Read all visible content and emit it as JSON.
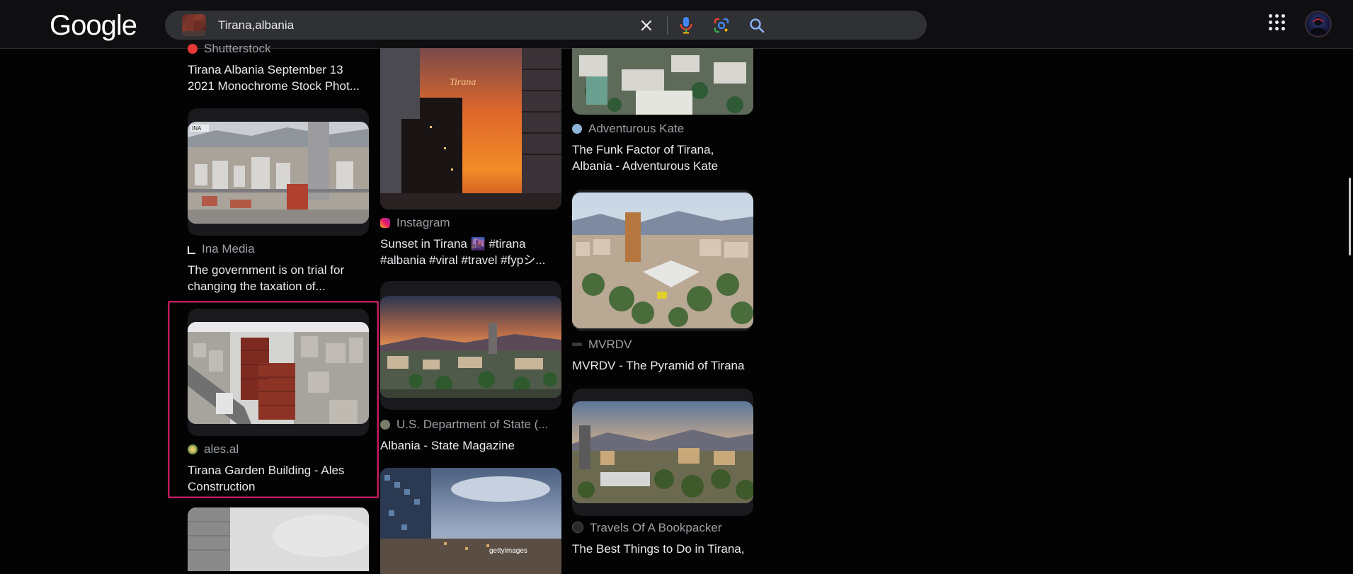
{
  "header": {
    "logo": "Google",
    "search": {
      "value": "Tirana,albania",
      "thumbnail": "tirana-building-thumbnail"
    },
    "icons": [
      "clear-icon",
      "mic-icon",
      "lens-icon",
      "search-icon",
      "apps-icon"
    ]
  },
  "results": {
    "col1": [
      {
        "source": "Shutterstock",
        "title": "Tirana Albania September 13 2021 Monochrome Stock Phot..."
      },
      {
        "source": "Ina Media",
        "title": "The government is on trial for changing the taxation of..."
      },
      {
        "source": "ales.al",
        "title": "Tirana Garden Building - Ales Construction"
      }
    ],
    "col2": [
      {
        "source": "Instagram",
        "title": "Sunset in Tirana 🌆 #tirana #albania #viral #travel #fypシ..."
      },
      {
        "source": "U.S. Department of State (...",
        "title": "Albania - State Magazine"
      }
    ],
    "col3": [
      {
        "source": "Adventurous Kate",
        "title": "The Funk Factor of Tirana, Albania - Adventurous Kate"
      },
      {
        "source": "MVRDV",
        "title": "MVRDV - The Pyramid of Tirana"
      },
      {
        "source": "Travels Of A Bookpacker",
        "title": "The Best Things to Do in Tirana,"
      }
    ],
    "image_watermarks": {
      "instagram_sunset": "Tirana",
      "bottom_getty": "gettyimages"
    }
  },
  "colors": {
    "background": "#030304",
    "card": "#1a1a1e",
    "highlight": "#c2185b",
    "searchbar": "#303134"
  }
}
